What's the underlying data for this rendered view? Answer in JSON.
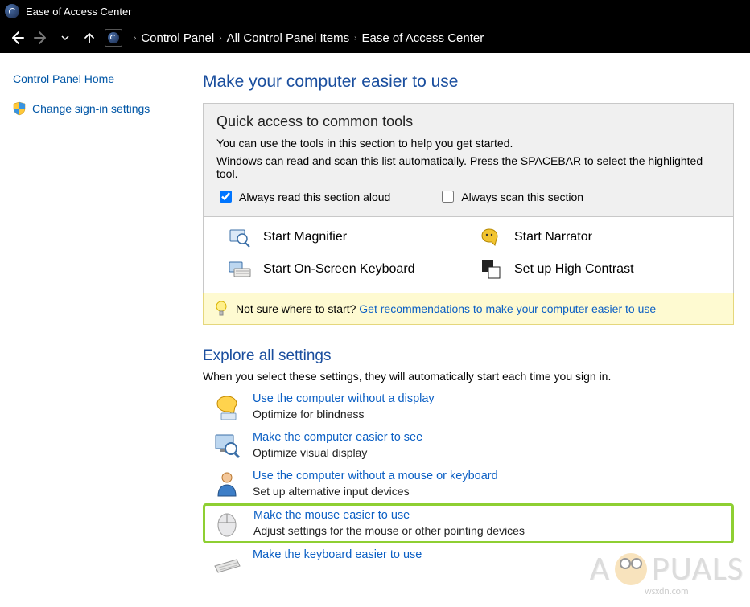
{
  "window": {
    "title": "Ease of Access Center"
  },
  "breadcrumb": {
    "items": [
      "Control Panel",
      "All Control Panel Items",
      "Ease of Access Center"
    ]
  },
  "sidebar": {
    "home": "Control Panel Home",
    "signin": "Change sign-in settings"
  },
  "page": {
    "title": "Make your computer easier to use"
  },
  "quick_access": {
    "title": "Quick access to common tools",
    "line1": "You can use the tools in this section to help you get started.",
    "line2": "Windows can read and scan this list automatically.  Press the SPACEBAR to select the highlighted tool.",
    "chk_read": {
      "label": "Always read this section aloud",
      "checked": true
    },
    "chk_scan": {
      "label": "Always scan this section",
      "checked": false
    },
    "tools": {
      "magnifier": "Start Magnifier",
      "narrator": "Start Narrator",
      "osk": "Start On-Screen Keyboard",
      "contrast": "Set up High Contrast"
    }
  },
  "tip": {
    "prefix": "Not sure where to start? ",
    "link": "Get recommendations to make your computer easier to use"
  },
  "explore": {
    "title": "Explore all settings",
    "sub": "When you select these settings, they will automatically start each time you sign in.",
    "items": [
      {
        "link": "Use the computer without a display",
        "desc": "Optimize for blindness",
        "icon": "display-off-icon"
      },
      {
        "link": "Make the computer easier to see",
        "desc": "Optimize visual display",
        "icon": "magnifier-screen-icon"
      },
      {
        "link": "Use the computer without a mouse or keyboard",
        "desc": "Set up alternative input devices",
        "icon": "person-icon"
      },
      {
        "link": "Make the mouse easier to use",
        "desc": "Adjust settings for the mouse or other pointing devices",
        "icon": "mouse-icon",
        "highlight": true
      },
      {
        "link": "Make the keyboard easier to use",
        "desc": "",
        "icon": "keyboard-icon"
      }
    ]
  },
  "watermark": {
    "brand_left": "A",
    "brand_right": "PUALS",
    "url": "wsxdn.com"
  }
}
